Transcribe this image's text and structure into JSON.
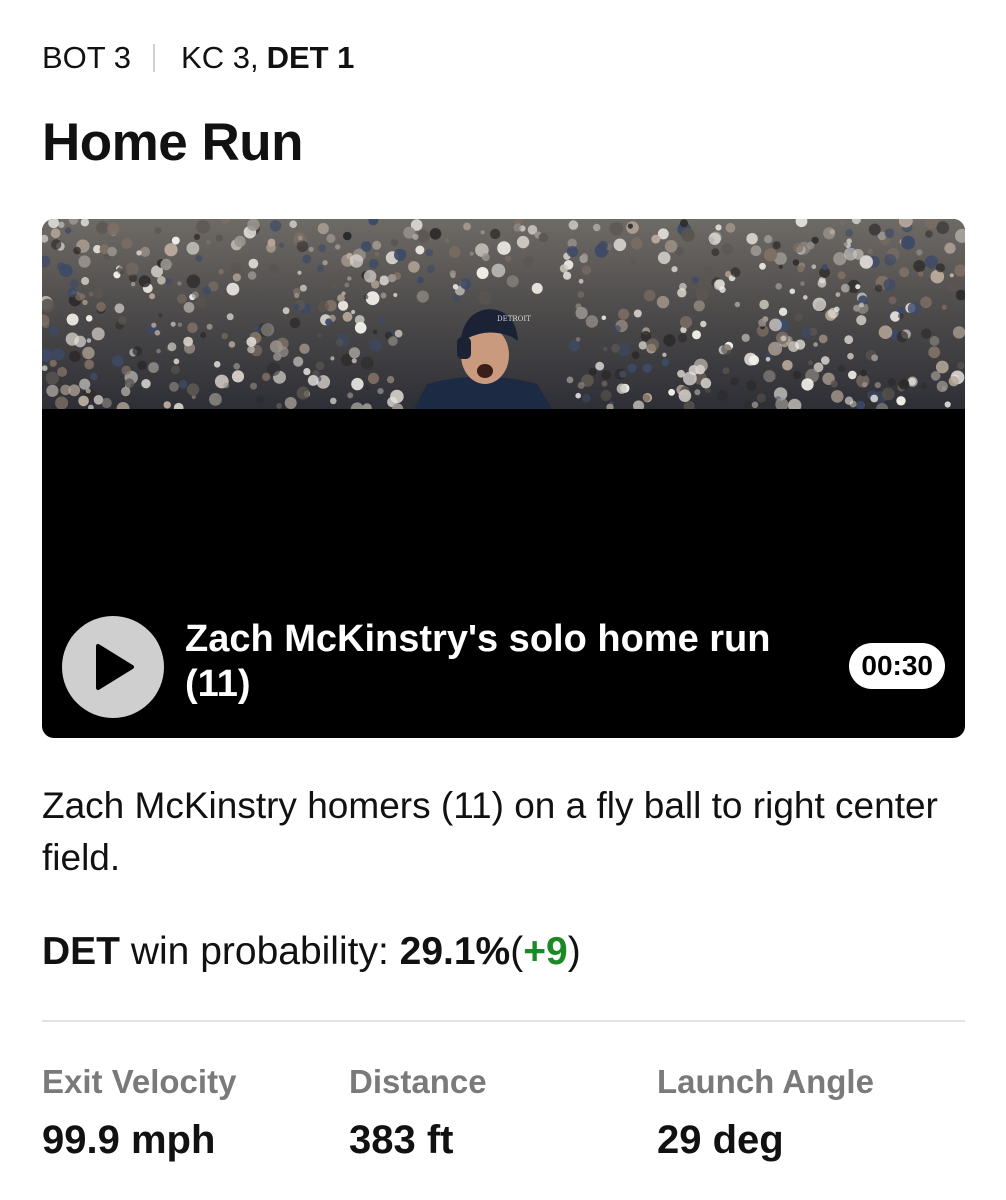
{
  "header": {
    "inning": "BOT 3",
    "score_away": "KC 3,",
    "score_home": "DET 1"
  },
  "play": {
    "title": "Home Run",
    "description": "Zach McKinstry homers (11) on a fly ball to right center field."
  },
  "video": {
    "title": "Zach McKinstry's solo home run (11)",
    "duration": "00:30",
    "helmet_text": "DETROIT"
  },
  "win_probability": {
    "team": "DET",
    "label": "win probability:",
    "value": "29.1%",
    "open_paren": "(",
    "change": "+9",
    "close_paren": ")",
    "change_color": "#1a8a24"
  },
  "stats": [
    {
      "label": "Exit Velocity",
      "value": "99.9 mph"
    },
    {
      "label": "Distance",
      "value": "383 ft"
    },
    {
      "label": "Launch Angle",
      "value": "29 deg"
    }
  ]
}
